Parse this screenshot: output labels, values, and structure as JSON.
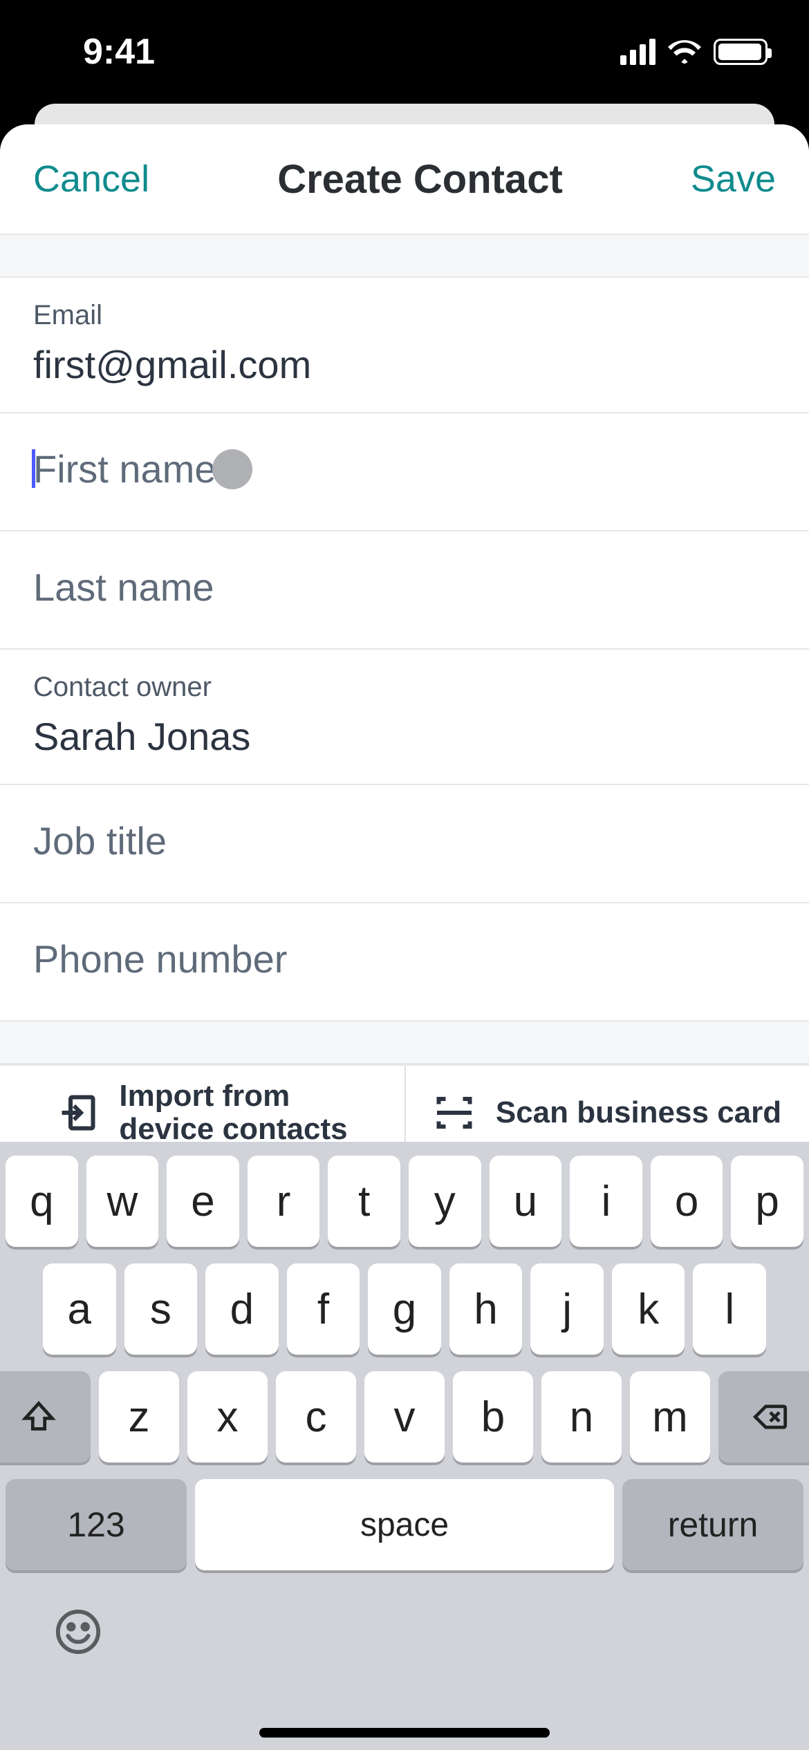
{
  "status": {
    "time": "9:41"
  },
  "nav": {
    "cancel": "Cancel",
    "title": "Create Contact",
    "save": "Save"
  },
  "fields": {
    "email": {
      "label": "Email",
      "value": "first@gmail.com"
    },
    "firstName": {
      "placeholder": "First name"
    },
    "lastName": {
      "placeholder": "Last name"
    },
    "owner": {
      "label": "Contact owner",
      "value": "Sarah Jonas"
    },
    "jobTitle": {
      "placeholder": "Job title"
    },
    "phone": {
      "placeholder": "Phone number"
    }
  },
  "actions": {
    "import": "Import from device contacts",
    "scan": "Scan business card"
  },
  "keyboard": {
    "row1": [
      "q",
      "w",
      "e",
      "r",
      "t",
      "y",
      "u",
      "i",
      "o",
      "p"
    ],
    "row2": [
      "a",
      "s",
      "d",
      "f",
      "g",
      "h",
      "j",
      "k",
      "l"
    ],
    "row3": [
      "z",
      "x",
      "c",
      "v",
      "b",
      "n",
      "m"
    ],
    "numKey": "123",
    "space": "space",
    "return": "return"
  }
}
